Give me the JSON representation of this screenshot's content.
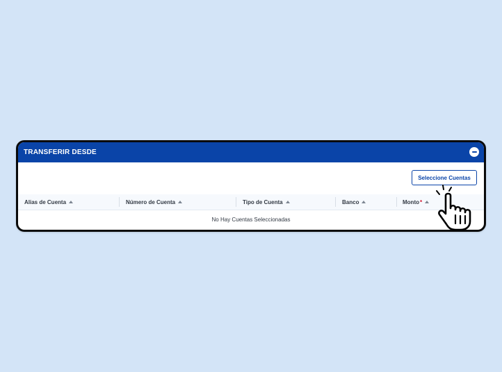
{
  "panel": {
    "title": "TRANSFERIR DESDE",
    "collapse_icon": "minus-circle-icon"
  },
  "actions": {
    "select_accounts_label": "Seleccione Cuentas"
  },
  "table": {
    "columns": [
      {
        "label": "Alias de Cuenta",
        "required_marker": ""
      },
      {
        "label": "Número de Cuenta",
        "required_marker": ""
      },
      {
        "label": "Tipo de Cuenta",
        "required_marker": ""
      },
      {
        "label": "Banco",
        "required_marker": ""
      },
      {
        "label": "Monto",
        "required_marker": "*"
      }
    ],
    "empty_message": "No Hay Cuentas Seleccionadas"
  },
  "colors": {
    "header_bg": "#0a44a8",
    "page_bg": "#d3e4f7",
    "required": "#d0142c"
  },
  "pointer": {
    "icon": "hand-pointer-icon"
  }
}
